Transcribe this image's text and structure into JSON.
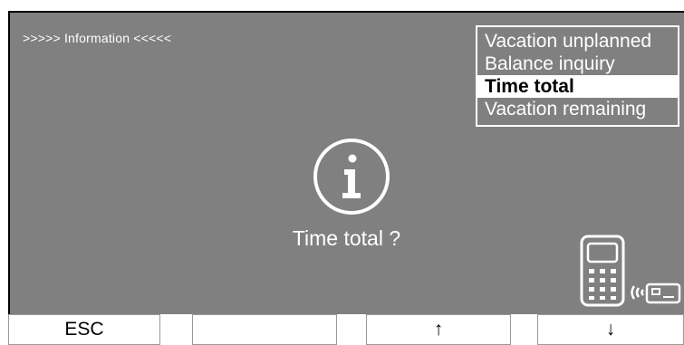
{
  "header": {
    "title": ">>>>> Information <<<<<"
  },
  "menu": {
    "items": [
      {
        "label": "Vacation unplanned",
        "selected": false
      },
      {
        "label": "Balance inquiry",
        "selected": false
      },
      {
        "label": "Time total",
        "selected": true
      },
      {
        "label": "Vacation remaining",
        "selected": false
      }
    ]
  },
  "main": {
    "icon": "info-icon",
    "prompt": "Time total ?"
  },
  "card_reader": {
    "icon": "contactless-card-reader-icon"
  },
  "function_keys": {
    "esc": "ESC",
    "blank": "",
    "up": "↑",
    "down": "↓"
  },
  "colors": {
    "display_bg": "#808080",
    "foreground": "#ffffff",
    "selected_text": "#000000"
  }
}
